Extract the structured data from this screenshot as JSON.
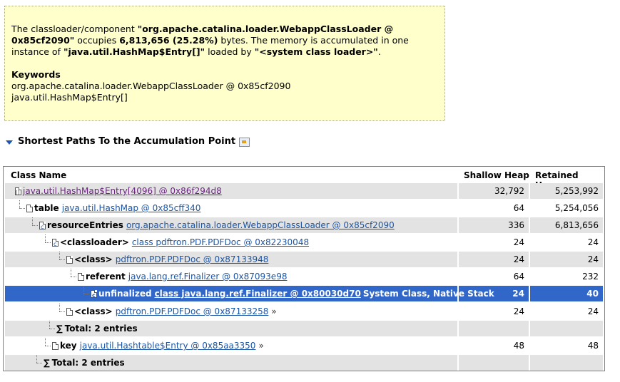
{
  "description": {
    "p1": "The classloader/component ",
    "b1": "\"org.apache.catalina.loader.WebappClassLoader @ 0x85cf2090\"",
    "p2": " occupies ",
    "b2": "6,813,656 (25.28%)",
    "p3": " bytes. The memory is accumulated in one instance of ",
    "b3": "\"java.util.HashMap$Entry[]\"",
    "p4": " loaded by ",
    "b4": "\"<system class loader>\"",
    "p5": ".",
    "keywords_title": "Keywords",
    "keywords": [
      "org.apache.catalina.loader.WebappClassLoader @ 0x85cf2090",
      "java.util.HashMap$Entry[]"
    ]
  },
  "section": {
    "title": "Shortest Paths To the Accumulation Point"
  },
  "table": {
    "columns": [
      "Class Name",
      "Shallow Heap",
      "Retained Heap"
    ],
    "rows": [
      {
        "field": "",
        "link": "java.util.HashMap$Entry[4096] @ 0x86f294d8",
        "extra": "",
        "more": "",
        "shallow": "32,792",
        "retained": "5,253,992",
        "icon": "array"
      },
      {
        "field": "table",
        "link": "java.util.HashMap @ 0x85cff340",
        "extra": "",
        "more": "",
        "shallow": "64",
        "retained": "5,254,056",
        "icon": "object"
      },
      {
        "field": "resourceEntries",
        "link": "org.apache.catalina.loader.WebappClassLoader @ 0x85cf2090",
        "extra": "",
        "more": "",
        "shallow": "336",
        "retained": "6,813,656",
        "icon": "class"
      },
      {
        "field": "<classloader>",
        "link": "class pdftron.PDF.PDFDoc @ 0x82230048",
        "extra": "",
        "more": "",
        "shallow": "24",
        "retained": "24",
        "icon": "class"
      },
      {
        "field": "<class>",
        "link": "pdftron.PDF.PDFDoc @ 0x87133948",
        "extra": "",
        "more": "",
        "shallow": "24",
        "retained": "24",
        "icon": "object"
      },
      {
        "field": "referent",
        "link": "java.lang.ref.Finalizer @ 0x87093e98",
        "extra": "",
        "more": "",
        "shallow": "64",
        "retained": "232",
        "icon": "object"
      },
      {
        "field": "unfinalized",
        "link": "class java.lang.ref.Finalizer @ 0x80030d70",
        "extra": "System Class, Native Stack",
        "more": "",
        "shallow": "24",
        "retained": "40",
        "icon": "class"
      },
      {
        "field": "<class>",
        "link": "pdftron.PDF.PDFDoc @ 0x87133258",
        "extra": "",
        "more": "»",
        "shallow": "24",
        "retained": "24",
        "icon": "object"
      },
      {
        "total": "Total: 2 entries"
      },
      {
        "field": "key",
        "link": "java.util.Hashtable$Entry @ 0x85aa3350",
        "extra": "",
        "more": "»",
        "shallow": "48",
        "retained": "48",
        "icon": "object"
      },
      {
        "total": "Total: 2 entries"
      }
    ]
  },
  "colors": {
    "selection": "#3167c9",
    "row_shade": "#e3e3e3",
    "link": "#1b55a6",
    "note_bg": "#ffffcc"
  }
}
